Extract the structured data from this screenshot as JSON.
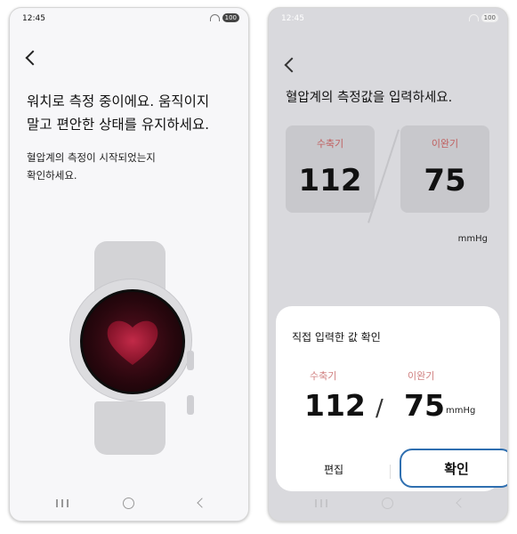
{
  "screens": {
    "left": {
      "status": {
        "time": "12:45",
        "battery": "100"
      },
      "heading_line1": "워치로 측정 중이에요. 움직이지",
      "heading_line2": "말고 편안한 상태를 유지하세요.",
      "subtext_line1": "혈압계의 측정이 시작되었는지",
      "subtext_line2": "확인하세요."
    },
    "right": {
      "status": {
        "time": "12:45",
        "battery": "100"
      },
      "heading": "혈압계의 측정값을 입력하세요.",
      "systolic": {
        "label": "수축기",
        "value": "112"
      },
      "diastolic": {
        "label": "이완기",
        "value": "75"
      },
      "unit": "mmHg",
      "sheet": {
        "title": "직접 입력한 값 확인",
        "systolic_label": "수축기",
        "systolic_value": "112",
        "separator": "/",
        "diastolic_label": "이완기",
        "diastolic_value": "75",
        "unit": "mmHg",
        "edit_label": "편집",
        "confirm_label": "확인"
      }
    }
  },
  "icons": {
    "back": "chevron-left-icon",
    "wifi": "wifi-icon",
    "watch": "smartwatch-illustration",
    "heart": "heart-icon"
  },
  "colors": {
    "label_red": "#c06060",
    "confirm_border": "#2f6fb0",
    "heart": "#a01834"
  }
}
